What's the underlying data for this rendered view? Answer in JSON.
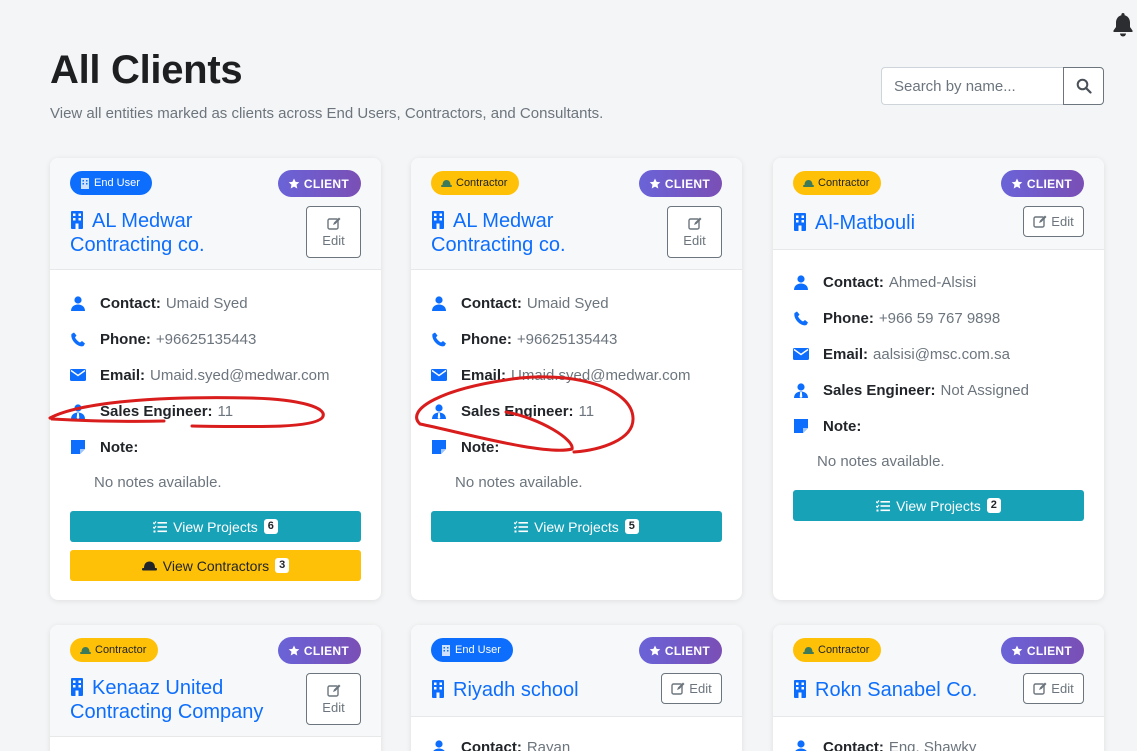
{
  "header": {
    "title": "All Clients",
    "subtitle": "View all entities marked as clients across End Users, Contractors, and Consultants.",
    "search_placeholder": "Search by name..."
  },
  "labels": {
    "contact": "Contact:",
    "phone": "Phone:",
    "email": "Email:",
    "sales_engineer": "Sales Engineer:",
    "note": "Note:",
    "client_badge": "CLIENT",
    "edit": "Edit",
    "view_projects": "View Projects",
    "view_contractors": "View Contractors"
  },
  "cards": [
    {
      "type": "End User",
      "name_line1": "AL Medwar",
      "name_line2": "Contracting co.",
      "contact": "Umaid Syed",
      "phone": "+96625135443",
      "email": "Umaid.syed@medwar.com",
      "sales_engineer": "11",
      "notes": "No notes available.",
      "projects_count": "6",
      "contractors_count": "3"
    },
    {
      "type": "Contractor",
      "name_line1": "AL Medwar",
      "name_line2": "Contracting co.",
      "contact": "Umaid Syed",
      "phone": "+96625135443",
      "email": "Umaid.syed@medwar.com",
      "sales_engineer": "11",
      "notes": "No notes available.",
      "projects_count": "5"
    },
    {
      "type": "Contractor",
      "name_line1": "Al-Matbouli",
      "contact": "Ahmed-Alsisi",
      "phone": "+966 59 767 9898",
      "email": "aalsisi@msc.com.sa",
      "sales_engineer": "Not Assigned",
      "notes": "No notes available.",
      "projects_count": "2"
    },
    {
      "type": "Contractor",
      "name_line1": "Kenaaz United",
      "name_line2": "Contracting Company"
    },
    {
      "type": "End User",
      "name_line1": "Riyadh school",
      "contact": "Rayan"
    },
    {
      "type": "Contractor",
      "name_line1": "Rokn Sanabel Co.",
      "contact": "Eng. Shawky"
    }
  ],
  "colors": {
    "primary": "#0d6efd",
    "teal": "#17a2b8",
    "warning": "#ffc107",
    "annotation": "#d91c1c"
  }
}
